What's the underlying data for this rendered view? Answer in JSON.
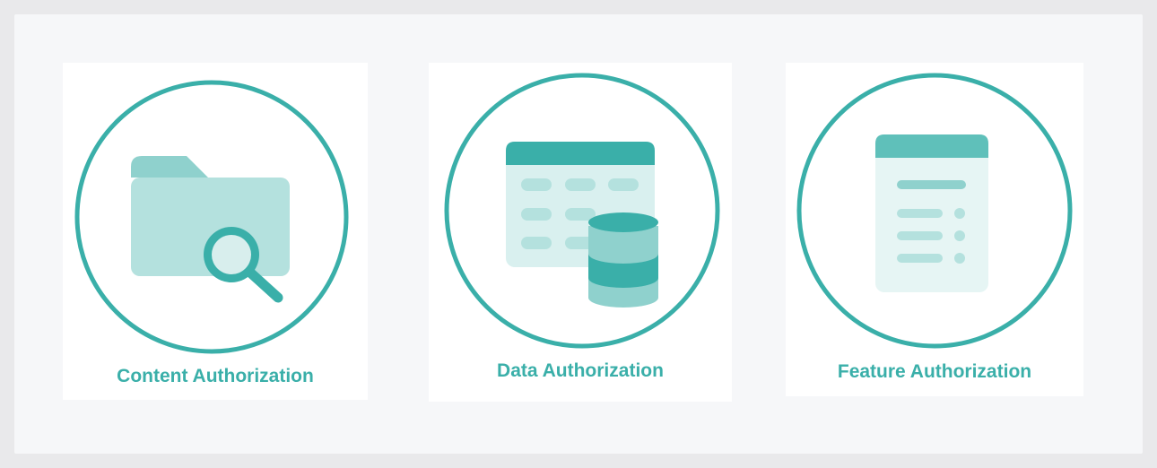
{
  "cards": [
    {
      "label": "Content Authorization",
      "icon": "folder-search-icon"
    },
    {
      "label": "Data Authorization",
      "icon": "database-table-icon"
    },
    {
      "label": "Feature Authorization",
      "icon": "feature-list-icon"
    }
  ],
  "colors": {
    "accent": "#3aafa9",
    "accent_light": "#8fd1cd",
    "accent_pale": "#b4e1de",
    "accent_faint": "#e6f5f4",
    "page_background": "#f6f7f9",
    "card_background": "#ffffff"
  }
}
